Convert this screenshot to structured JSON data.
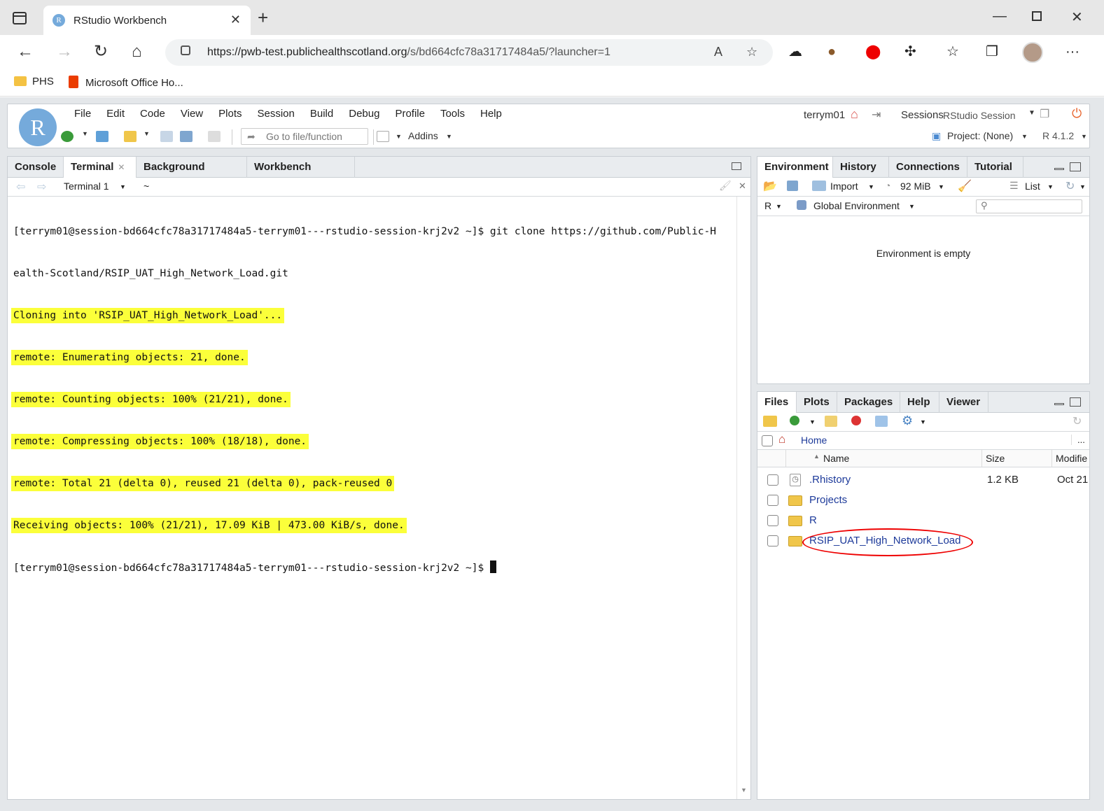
{
  "browser": {
    "tab_title": "RStudio Workbench",
    "tab_favicon": "R",
    "url_host": "https://pwb-test.publichealthscotland.org",
    "url_path": "/s/bd664cfc78a31717484a5/?launcher=1",
    "bookmarks": [
      "PHS",
      "Microsoft Office Ho..."
    ]
  },
  "rstudio": {
    "logo": "R",
    "menu": [
      "File",
      "Edit",
      "Code",
      "View",
      "Plots",
      "Session",
      "Build",
      "Debug",
      "Profile",
      "Tools",
      "Help"
    ],
    "user": "terrym01",
    "sessions_label": "Sessions",
    "session_name": "RStudio Session",
    "goto_placeholder": "Go to file/function",
    "addins": "Addins",
    "project": "Project: (None)",
    "r_version": "R 4.1.2"
  },
  "left_pane": {
    "tabs": [
      {
        "label": "Console",
        "closable": false
      },
      {
        "label": "Terminal",
        "closable": true
      },
      {
        "label": "Background Jobs",
        "closable": true
      },
      {
        "label": "Workbench Jobs",
        "closable": true
      }
    ],
    "terminal_select": "Terminal 1",
    "terminal_dir": "~",
    "lines": [
      {
        "text": "[terrym01@session-bd664cfc78a31717484a5-terrym01---rstudio-session-krj2v2 ~]$ git clone https://github.com/Public-H",
        "hl": false
      },
      {
        "text": "ealth-Scotland/RSIP_UAT_High_Network_Load.git",
        "hl": false
      },
      {
        "text": "Cloning into 'RSIP_UAT_High_Network_Load'...",
        "hl": true
      },
      {
        "text": "remote: Enumerating objects: 21, done.",
        "hl": true
      },
      {
        "text": "remote: Counting objects: 100% (21/21), done.",
        "hl": true
      },
      {
        "text": "remote: Compressing objects: 100% (18/18), done.",
        "hl": true
      },
      {
        "text": "remote: Total 21 (delta 0), reused 21 (delta 0), pack-reused 0",
        "hl": true
      },
      {
        "text": "Receiving objects: 100% (21/21), 17.09 KiB | 473.00 KiB/s, done.",
        "hl": true
      },
      {
        "text": "[terrym01@session-bd664cfc78a31717484a5-terrym01---rstudio-session-krj2v2 ~]$ ",
        "hl": false
      }
    ]
  },
  "env_pane": {
    "tabs": [
      "Environment",
      "History",
      "Connections",
      "Tutorial"
    ],
    "import": "Import",
    "memory": "92 MiB",
    "view": "List",
    "lang": "R",
    "scope": "Global Environment",
    "empty_msg": "Environment is empty"
  },
  "files_pane": {
    "tabs": [
      "Files",
      "Plots",
      "Packages",
      "Help",
      "Viewer"
    ],
    "breadcrumb": "Home",
    "more": "...",
    "columns": {
      "name": "Name",
      "size": "Size",
      "modified": "Modifie"
    },
    "rows": [
      {
        "name": ".Rhistory",
        "size": "1.2 KB",
        "modified": "Oct 21",
        "type": "file"
      },
      {
        "name": "Projects",
        "size": "",
        "modified": "",
        "type": "folder"
      },
      {
        "name": "R",
        "size": "",
        "modified": "",
        "type": "folder"
      },
      {
        "name": "RSIP_UAT_High_Network_Load",
        "size": "",
        "modified": "",
        "type": "folder"
      }
    ]
  },
  "colors": {
    "highlight": "#fbff3a",
    "annotation": "#e00000",
    "link": "#1d3a9a",
    "r_blue": "#75aadb"
  }
}
